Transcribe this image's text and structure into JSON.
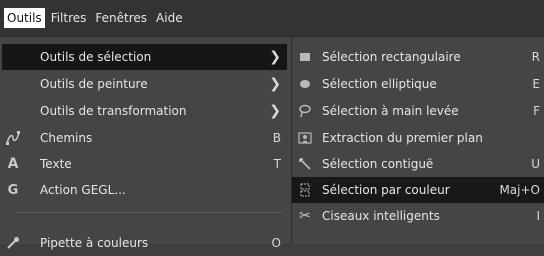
{
  "menubar": {
    "items": [
      "Outils",
      "Filtres",
      "Fenêtres",
      "Aide"
    ]
  },
  "tools_menu": {
    "items": [
      {
        "label": "Outils de sélection",
        "shortcut": "",
        "icon": "none",
        "submenu": true
      },
      {
        "label": "Outils de peinture",
        "shortcut": "",
        "icon": "none",
        "submenu": true
      },
      {
        "label": "Outils de transformation",
        "shortcut": "",
        "icon": "none",
        "submenu": true
      },
      {
        "label": "Chemins",
        "shortcut": "B",
        "icon": "paths-icon",
        "submenu": false
      },
      {
        "label": "Texte",
        "shortcut": "T",
        "icon": "text-icon",
        "submenu": false
      },
      {
        "label": "Action GEGL...",
        "shortcut": "",
        "icon": "gegl-icon",
        "submenu": false
      },
      {
        "label": "Pipette à couleurs",
        "shortcut": "O",
        "icon": "color-picker-icon",
        "submenu": false
      }
    ]
  },
  "selection_submenu": {
    "items": [
      {
        "label": "Sélection rectangulaire",
        "shortcut": "R",
        "icon": "rect-select-icon"
      },
      {
        "label": "Sélection elliptique",
        "shortcut": "E",
        "icon": "ellipse-select-icon"
      },
      {
        "label": "Sélection à main levée",
        "shortcut": "F",
        "icon": "free-select-icon"
      },
      {
        "label": "Extraction du premier plan",
        "shortcut": "",
        "icon": "foreground-select-icon"
      },
      {
        "label": "Sélection contiguë",
        "shortcut": "U",
        "icon": "fuzzy-select-icon"
      },
      {
        "label": "Sélection par couleur",
        "shortcut": "Maj+O",
        "icon": "select-by-color-icon"
      },
      {
        "label": "Ciseaux intelligents",
        "shortcut": "I",
        "icon": "scissors-icon"
      }
    ]
  },
  "colors": {
    "menu_bg": "#454545",
    "highlight": "#161616",
    "menubar_bg": "#333333",
    "active_menubar": "#ffffff"
  }
}
